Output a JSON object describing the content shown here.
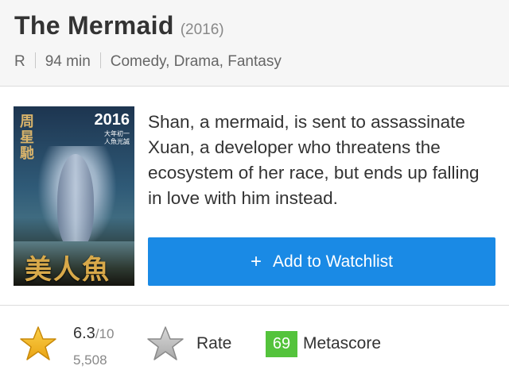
{
  "movie": {
    "title": "The Mermaid",
    "year": "(2016)",
    "rating_cert": "R",
    "runtime": "94 min",
    "genres": "Comedy, Drama, Fantasy"
  },
  "poster": {
    "year_text": "2016",
    "subtitle_line1": "大年初一",
    "subtitle_line2": "人魚光誠",
    "director_vertical": "周星馳",
    "title_text": "美人魚"
  },
  "description": "Shan, a mermaid, is sent to assassinate Xuan, a developer who threatens the ecosystem of her race, but ends up falling in love with him instead.",
  "watchlist_button": {
    "icon": "+",
    "label": "Add to Watchlist",
    "color": "#1a8ae5"
  },
  "ratings": {
    "score": "6.3",
    "out_of": "/10",
    "votes": "5,508",
    "rate_label": "Rate",
    "metascore": "69",
    "metascore_label": "Metascore",
    "metascore_color": "#54c33c",
    "star_icon": "star-filled-icon",
    "rate_icon": "star-outline-icon"
  }
}
